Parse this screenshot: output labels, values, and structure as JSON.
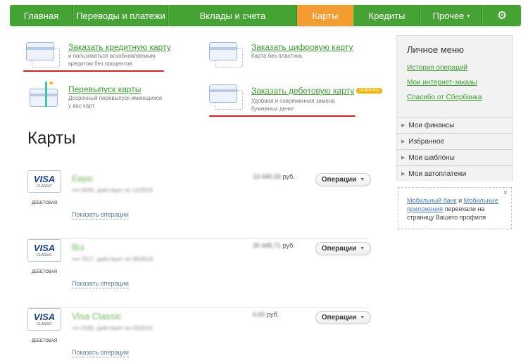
{
  "nav": {
    "items": [
      "Главная",
      "Переводы и платежи",
      "Вклады и счета",
      "Карты",
      "Кредиты",
      "Прочее"
    ],
    "active_index": 3,
    "more_caret": "▾",
    "settings_icon": "gear-icon"
  },
  "actions": {
    "order_credit": {
      "title": "Заказать кредитную карту",
      "desc1": "и пользоваться возобновляемым",
      "desc2": "кредитом без процентов"
    },
    "order_digital": {
      "title": "Заказать цифровую карту",
      "desc1": "Карта без пластика"
    },
    "reissue": {
      "title": "Перевыпуск карты",
      "desc1": "Досрочный перевыпуск имеющихся",
      "desc2": "у вас карт"
    },
    "order_debit": {
      "title": "Заказать дебетовую карту",
      "badge": "НОВИНКА",
      "desc1": "Удобная и современная замена",
      "desc2": "бумажных денег"
    }
  },
  "page_title": "Карты",
  "cards": [
    {
      "brand": "VISA",
      "brand_sub": "CLASSIC",
      "type": "ДЕБЕТОВАЯ",
      "name": "Евро",
      "meta": "•••• 0000, действует по 12/2019",
      "amount": "13 440,33",
      "currency": "руб.",
      "ops_label": "Операции",
      "show_ops": "Показать операции"
    },
    {
      "brand": "VISA",
      "brand_sub": "CLASSIC",
      "type": "ДЕБЕТОВАЯ",
      "name": "Віз",
      "meta": "•••• 7017, действует по 09/2019",
      "amount": "20 445,71",
      "currency": "руб.",
      "ops_label": "Операции",
      "show_ops": "Показать операции"
    },
    {
      "brand": "VISA",
      "brand_sub": "CLASSIC",
      "type": "ДЕБЕТОВАЯ",
      "name": "Visa Classic",
      "meta": "•••• 0182, действует по 03/2016",
      "amount": "0,00",
      "currency": "руб.",
      "ops_label": "Операции",
      "show_ops": "Показать операции"
    }
  ],
  "sidebar": {
    "title": "Личное меню",
    "links": [
      "История операций",
      "Мои интернет-заказы",
      "Спасибо от Сбербанка"
    ],
    "menu": [
      "Мои финансы",
      "Избранное",
      "Мои шаблоны",
      "Мои автоплатежи"
    ]
  },
  "note": {
    "link1": "Мобильный банк",
    "and": " и ",
    "link2": "Мобильные приложения",
    "rest": " переехали на страницу Вашего профиля",
    "close": "×"
  }
}
